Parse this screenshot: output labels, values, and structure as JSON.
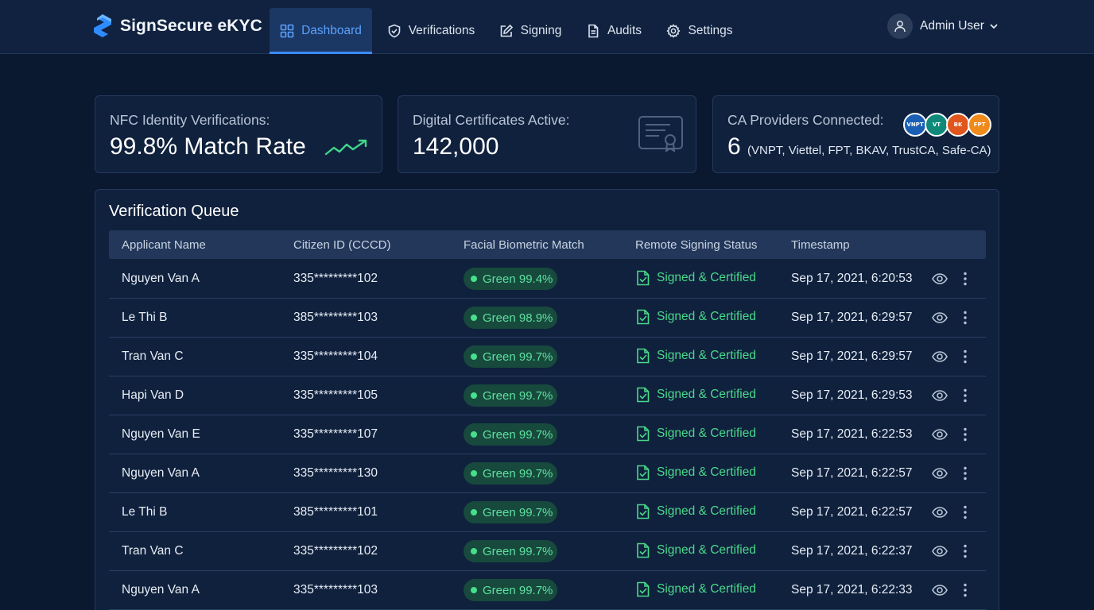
{
  "brand": {
    "name": "SignSecure eKYC"
  },
  "nav": {
    "items": [
      {
        "label": "Dashboard",
        "icon": "dashboard-grid-icon",
        "active": true
      },
      {
        "label": "Verifications",
        "icon": "shield-check-icon"
      },
      {
        "label": "Signing",
        "icon": "pen-edit-icon"
      },
      {
        "label": "Audits",
        "icon": "document-icon"
      },
      {
        "label": "Settings",
        "icon": "gear-icon"
      }
    ]
  },
  "user": {
    "name": "Admin User",
    "icon": "user-avatar-icon"
  },
  "stats": {
    "nfc": {
      "label": "NFC Identity Verifications:",
      "value": "99.8% Match Rate",
      "icon": "trend-up-icon"
    },
    "certs": {
      "label": "Digital Certificates Active:",
      "value": "142,000",
      "icon": "certificate-icon"
    },
    "ca": {
      "label": "CA Providers Connected:",
      "count": "6",
      "detail": "(VNPT, Viettel, FPT, BKAV, TrustCA, Safe-CA)",
      "logos": [
        {
          "text": "VNPT",
          "color": "#1a5fb4"
        },
        {
          "text": "VT",
          "color": "#0f8a7a"
        },
        {
          "text": "BK",
          "color": "#e0561c"
        },
        {
          "text": "FPT",
          "color": "#f08a1a"
        }
      ]
    }
  },
  "queue": {
    "title": "Verification Queue",
    "columns": [
      "Applicant Name",
      "Citizen ID (CCCD)",
      "Facial Biometric Match",
      "Remote Signing Status",
      "Timestamp"
    ],
    "rows": [
      {
        "name": "Nguyen Van A",
        "id": "335*********102",
        "match": "Green 99.4%",
        "status": "Signed & Certified",
        "time": "Sep 17, 2021, 6:20:53"
      },
      {
        "name": "Le Thi B",
        "id": "385*********103",
        "match": "Green 98.9%",
        "status": "Signed & Certified",
        "time": "Sep 17, 2021, 6:29:57"
      },
      {
        "name": "Tran Van C",
        "id": "335*********104",
        "match": "Green 99.7%",
        "status": "Signed & Certified",
        "time": "Sep 17, 2021, 6:29:57"
      },
      {
        "name": "Hapi Van D",
        "id": "335*********105",
        "match": "Green 99.7%",
        "status": "Signed & Certified",
        "time": "Sep 17, 2021, 6:29:53"
      },
      {
        "name": "Nguyen Van E",
        "id": "335*********107",
        "match": "Green 99.7%",
        "status": "Signed & Certified",
        "time": "Sep 17, 2021, 6:22:53"
      },
      {
        "name": "Nguyen Van A",
        "id": "335*********130",
        "match": "Green 99.7%",
        "status": "Signed & Certified",
        "time": "Sep 17, 2021, 6:22:57"
      },
      {
        "name": "Le Thi B",
        "id": "385*********101",
        "match": "Green 99.7%",
        "status": "Signed & Certified",
        "time": "Sep 17, 2021, 6:22:57"
      },
      {
        "name": "Tran Van C",
        "id": "335*********102",
        "match": "Green 99.7%",
        "status": "Signed & Certified",
        "time": "Sep 17, 2021, 6:22:37"
      },
      {
        "name": "Nguyen Van A",
        "id": "335*********103",
        "match": "Green 99.7%",
        "status": "Signed & Certified",
        "time": "Sep 17, 2021, 6:22:33"
      }
    ],
    "row_actions": [
      "eye-icon",
      "more-vertical-icon"
    ]
  },
  "colors": {
    "background": "#0a1830",
    "nav": "#10223f",
    "card": "#10213d",
    "accent": "#3b8cff",
    "success": "#49d98a",
    "pill": "#174a3d"
  }
}
